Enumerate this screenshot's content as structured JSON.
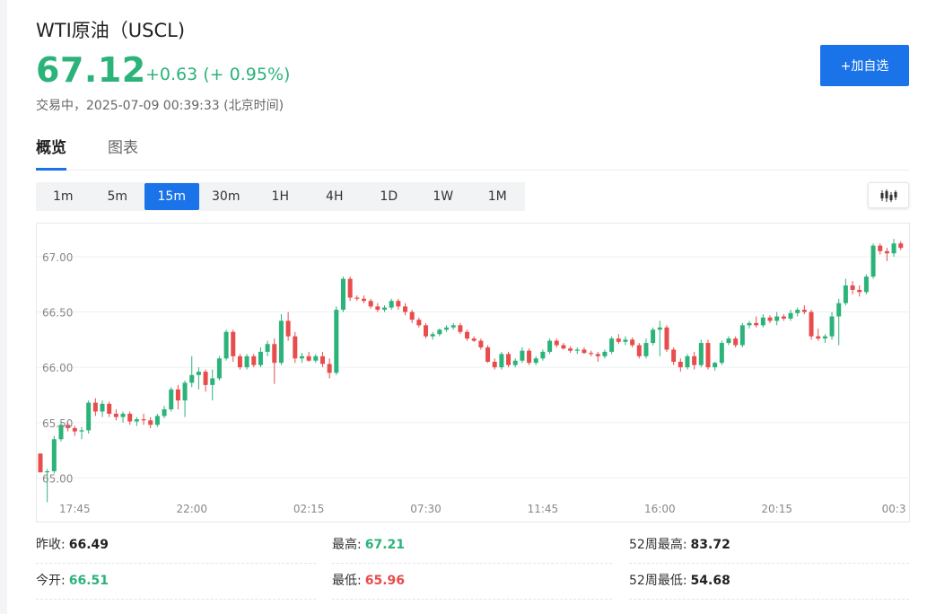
{
  "header": {
    "title": "WTI原油（USCL)",
    "price": "67.12",
    "change": "+0.63 (+ 0.95%)",
    "status": "交易中，2025-07-09 00:39:33 (北京时间)",
    "add_button": "+加自选"
  },
  "colors": {
    "up": "#2bb37a",
    "down": "#e84c4c",
    "accent": "#1a73e8"
  },
  "tabs": [
    {
      "label": "概览",
      "active": true
    },
    {
      "label": "图表",
      "active": false
    }
  ],
  "intervals": [
    "1m",
    "5m",
    "15m",
    "30m",
    "1H",
    "4H",
    "1D",
    "1W",
    "1M"
  ],
  "active_interval": "15m",
  "chart_type_icon": "candlestick-icon",
  "stats": {
    "prev_close_label": "昨收:",
    "prev_close": "66.49",
    "high_label": "最高:",
    "high": "67.21",
    "high52_label": "52周最高:",
    "high52": "83.72",
    "open_label": "今开:",
    "open": "66.51",
    "low_label": "最低:",
    "low": "65.96",
    "low52_label": "52周最低:",
    "low52": "54.68"
  },
  "chart_data": {
    "type": "candlestick",
    "ylim": [
      64.8,
      67.3
    ],
    "y_ticks": [
      "67.00",
      "66.50",
      "66.00",
      "65.50",
      "65.00"
    ],
    "y_tick_values": [
      67.0,
      66.5,
      66.0,
      65.5,
      65.0
    ],
    "x_ticks": [
      "17:45",
      "22:00",
      "02:15",
      "07:30",
      "11:45",
      "16:00",
      "20:15",
      "00:3"
    ],
    "x_tick_index": [
      5,
      22,
      39,
      56,
      73,
      90,
      107,
      124
    ],
    "grid": true,
    "candles": [
      [
        65.22,
        65.22,
        65.05,
        65.05
      ],
      [
        65.05,
        65.08,
        64.78,
        65.06
      ],
      [
        65.06,
        65.38,
        65.04,
        65.35
      ],
      [
        65.35,
        65.5,
        65.33,
        65.48
      ],
      [
        65.48,
        65.5,
        65.42,
        65.45
      ],
      [
        65.45,
        65.47,
        65.38,
        65.42
      ],
      [
        65.42,
        65.46,
        65.35,
        65.43
      ],
      [
        65.43,
        65.7,
        65.4,
        65.68
      ],
      [
        65.68,
        65.72,
        65.56,
        65.6
      ],
      [
        65.6,
        65.7,
        65.55,
        65.67
      ],
      [
        65.67,
        65.69,
        65.55,
        65.58
      ],
      [
        65.58,
        65.62,
        65.52,
        65.55
      ],
      [
        65.55,
        65.6,
        65.5,
        65.58
      ],
      [
        65.58,
        65.6,
        65.48,
        65.51
      ],
      [
        65.51,
        65.55,
        65.47,
        65.53
      ],
      [
        65.53,
        65.58,
        65.48,
        65.52
      ],
      [
        65.52,
        65.55,
        65.45,
        65.48
      ],
      [
        65.48,
        65.58,
        65.46,
        65.56
      ],
      [
        65.56,
        65.65,
        65.54,
        65.62
      ],
      [
        65.62,
        65.82,
        65.6,
        65.8
      ],
      [
        65.8,
        65.84,
        65.62,
        65.7
      ],
      [
        65.7,
        65.88,
        65.55,
        65.86
      ],
      [
        65.86,
        66.1,
        65.82,
        65.93
      ],
      [
        65.93,
        66.0,
        65.8,
        65.96
      ],
      [
        65.96,
        65.98,
        65.78,
        65.84
      ],
      [
        65.84,
        65.98,
        65.7,
        65.9
      ],
      [
        65.9,
        66.1,
        65.88,
        66.08
      ],
      [
        66.08,
        66.34,
        66.06,
        66.32
      ],
      [
        66.32,
        66.34,
        66.05,
        66.1
      ],
      [
        66.1,
        66.12,
        65.98,
        66.0
      ],
      [
        66.0,
        66.12,
        65.98,
        66.1
      ],
      [
        66.1,
        66.12,
        66.0,
        66.02
      ],
      [
        66.02,
        66.18,
        66.0,
        66.14
      ],
      [
        66.14,
        66.24,
        66.1,
        66.21
      ],
      [
        66.21,
        66.26,
        65.85,
        66.04
      ],
      [
        66.04,
        66.48,
        66.02,
        66.42
      ],
      [
        66.42,
        66.5,
        66.24,
        66.28
      ],
      [
        66.28,
        66.32,
        66.04,
        66.08
      ],
      [
        66.08,
        66.13,
        66.04,
        66.1
      ],
      [
        66.1,
        66.14,
        66.05,
        66.06
      ],
      [
        66.06,
        66.12,
        66.04,
        66.1
      ],
      [
        66.1,
        66.14,
        66.0,
        66.03
      ],
      [
        66.03,
        66.08,
        65.9,
        65.95
      ],
      [
        65.95,
        66.55,
        65.93,
        66.52
      ],
      [
        66.52,
        66.82,
        66.5,
        66.8
      ],
      [
        66.8,
        66.82,
        66.6,
        66.63
      ],
      [
        66.63,
        66.65,
        66.6,
        66.62
      ],
      [
        66.62,
        66.65,
        66.58,
        66.6
      ],
      [
        66.6,
        66.62,
        66.53,
        66.55
      ],
      [
        66.55,
        66.58,
        66.5,
        66.52
      ],
      [
        66.52,
        66.56,
        66.5,
        66.54
      ],
      [
        66.54,
        66.62,
        66.52,
        66.6
      ],
      [
        66.6,
        66.62,
        66.52,
        66.55
      ],
      [
        66.55,
        66.58,
        66.47,
        66.5
      ],
      [
        66.5,
        66.52,
        66.4,
        66.43
      ],
      [
        66.43,
        66.45,
        66.36,
        66.38
      ],
      [
        66.38,
        66.4,
        66.26,
        66.28
      ],
      [
        66.28,
        66.32,
        66.25,
        66.3
      ],
      [
        66.3,
        66.35,
        66.28,
        66.34
      ],
      [
        66.34,
        66.38,
        66.32,
        66.36
      ],
      [
        66.36,
        66.4,
        66.34,
        66.38
      ],
      [
        66.38,
        66.4,
        66.3,
        66.32
      ],
      [
        66.32,
        66.34,
        66.24,
        66.26
      ],
      [
        66.26,
        66.28,
        66.23,
        66.24
      ],
      [
        66.24,
        66.26,
        66.16,
        66.18
      ],
      [
        66.18,
        66.2,
        66.04,
        66.05
      ],
      [
        66.05,
        66.08,
        65.98,
        66.0
      ],
      [
        66.0,
        66.14,
        65.98,
        66.12
      ],
      [
        66.12,
        66.14,
        66.0,
        66.02
      ],
      [
        66.02,
        66.08,
        66.0,
        66.06
      ],
      [
        66.06,
        66.18,
        66.04,
        66.15
      ],
      [
        66.15,
        66.17,
        66.02,
        66.04
      ],
      [
        66.04,
        66.1,
        66.02,
        66.08
      ],
      [
        66.08,
        66.16,
        66.06,
        66.14
      ],
      [
        66.14,
        66.26,
        66.12,
        66.24
      ],
      [
        66.24,
        66.26,
        66.18,
        66.2
      ],
      [
        66.2,
        66.22,
        66.16,
        66.17
      ],
      [
        66.17,
        66.19,
        66.13,
        66.15
      ],
      [
        66.15,
        66.18,
        66.12,
        66.16
      ],
      [
        66.16,
        66.18,
        66.12,
        66.13
      ],
      [
        66.13,
        66.15,
        66.1,
        66.12
      ],
      [
        66.12,
        66.14,
        66.05,
        66.1
      ],
      [
        66.1,
        66.16,
        66.08,
        66.14
      ],
      [
        66.14,
        66.28,
        66.12,
        66.26
      ],
      [
        66.26,
        66.3,
        66.21,
        66.23
      ],
      [
        66.23,
        66.28,
        66.2,
        66.25
      ],
      [
        66.25,
        66.27,
        66.18,
        66.2
      ],
      [
        66.2,
        66.22,
        66.08,
        66.1
      ],
      [
        66.1,
        66.26,
        66.08,
        66.22
      ],
      [
        66.22,
        66.36,
        66.2,
        66.34
      ],
      [
        66.34,
        66.42,
        66.1,
        66.36
      ],
      [
        66.36,
        66.38,
        66.14,
        66.16
      ],
      [
        66.16,
        66.18,
        66.02,
        66.05
      ],
      [
        66.05,
        66.08,
        65.96,
        66.0
      ],
      [
        66.0,
        66.12,
        65.98,
        66.1
      ],
      [
        66.1,
        66.14,
        65.98,
        66.02
      ],
      [
        66.02,
        66.25,
        66.0,
        66.22
      ],
      [
        66.22,
        66.25,
        65.98,
        66.0
      ],
      [
        66.0,
        66.05,
        65.97,
        66.04
      ],
      [
        66.04,
        66.24,
        66.02,
        66.22
      ],
      [
        66.22,
        66.28,
        66.2,
        66.26
      ],
      [
        66.26,
        66.28,
        66.18,
        66.2
      ],
      [
        66.2,
        66.4,
        66.18,
        66.38
      ],
      [
        66.38,
        66.42,
        66.35,
        66.4
      ],
      [
        66.4,
        66.46,
        66.36,
        66.38
      ],
      [
        66.38,
        66.48,
        66.36,
        66.45
      ],
      [
        66.45,
        66.47,
        66.4,
        66.42
      ],
      [
        66.42,
        66.5,
        66.38,
        66.46
      ],
      [
        66.46,
        66.48,
        66.42,
        66.44
      ],
      [
        66.44,
        66.52,
        66.42,
        66.49
      ],
      [
        66.49,
        66.54,
        66.46,
        66.52
      ],
      [
        66.52,
        66.56,
        66.48,
        66.5
      ],
      [
        66.5,
        66.52,
        66.25,
        66.28
      ],
      [
        66.28,
        66.35,
        66.24,
        66.26
      ],
      [
        66.26,
        66.3,
        66.22,
        66.28
      ],
      [
        66.28,
        66.5,
        66.25,
        66.46
      ],
      [
        66.46,
        66.62,
        66.2,
        66.58
      ],
      [
        66.58,
        66.8,
        66.56,
        66.74
      ],
      [
        66.74,
        66.78,
        66.66,
        66.7
      ],
      [
        66.7,
        66.74,
        66.64,
        66.68
      ],
      [
        66.68,
        66.84,
        66.66,
        66.82
      ],
      [
        66.82,
        67.12,
        66.8,
        67.1
      ],
      [
        67.1,
        67.12,
        67.02,
        67.05
      ],
      [
        67.05,
        67.08,
        66.96,
        67.03
      ],
      [
        67.03,
        67.16,
        67.0,
        67.12
      ],
      [
        67.12,
        67.14,
        67.06,
        67.08
      ]
    ]
  }
}
